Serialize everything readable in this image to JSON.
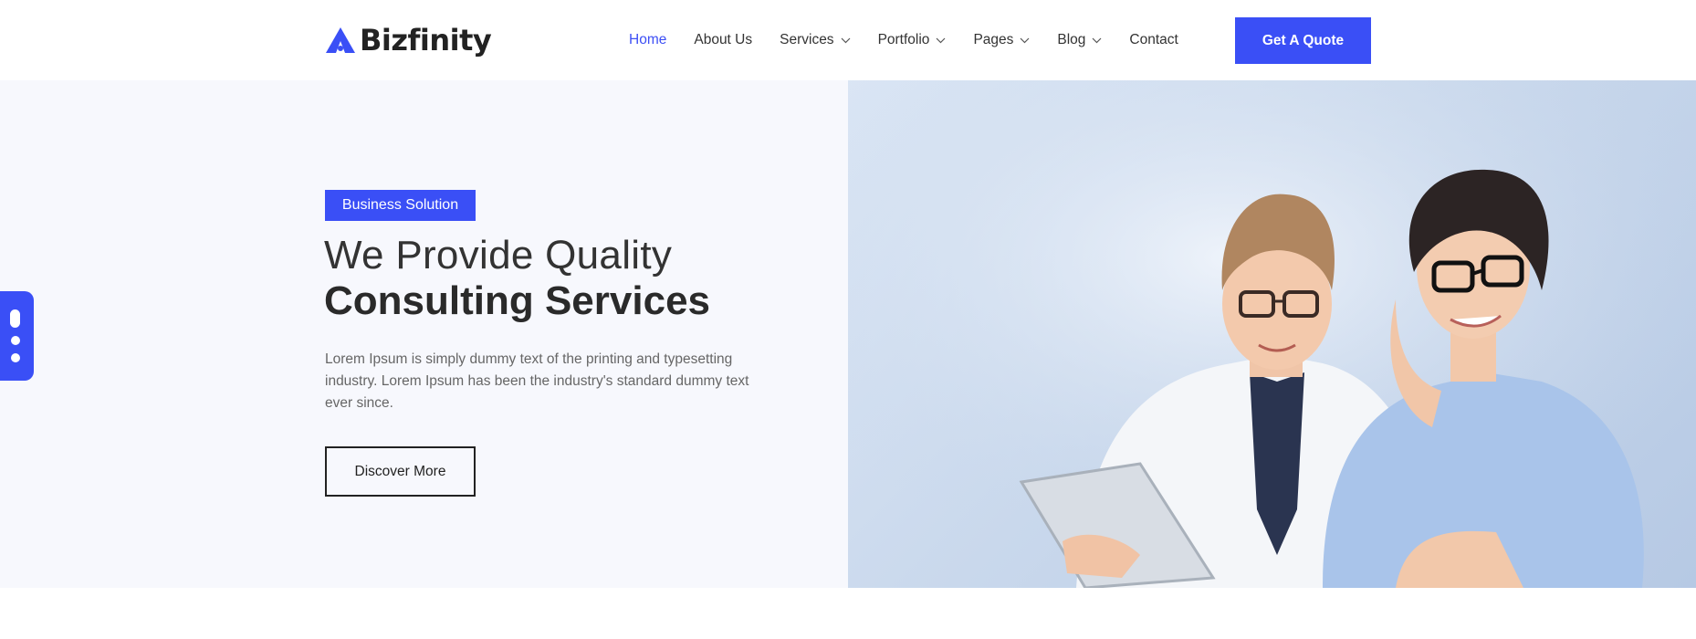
{
  "brand": {
    "name": "Bizfinity",
    "accent": "#3a4ff6"
  },
  "nav": {
    "items": [
      {
        "label": "Home",
        "active": true,
        "dropdown": false
      },
      {
        "label": "About Us",
        "active": false,
        "dropdown": false
      },
      {
        "label": "Services",
        "active": false,
        "dropdown": true
      },
      {
        "label": "Portfolio",
        "active": false,
        "dropdown": true
      },
      {
        "label": "Pages",
        "active": false,
        "dropdown": true
      },
      {
        "label": "Blog",
        "active": false,
        "dropdown": true
      },
      {
        "label": "Contact",
        "active": false,
        "dropdown": false
      }
    ],
    "cta_label": "Get A Quote"
  },
  "hero": {
    "badge": "Business Solution",
    "title_light": "We Provide Quality",
    "title_bold": "Consulting Services",
    "description": "Lorem Ipsum is simply dummy text of the printing and typesetting industry. Lorem Ipsum has been the industry's standard dummy text ever since.",
    "cta_label": "Discover More",
    "image_icon": "business-people-photo"
  },
  "side_widget": {
    "icon": "settings-dots-icon"
  }
}
